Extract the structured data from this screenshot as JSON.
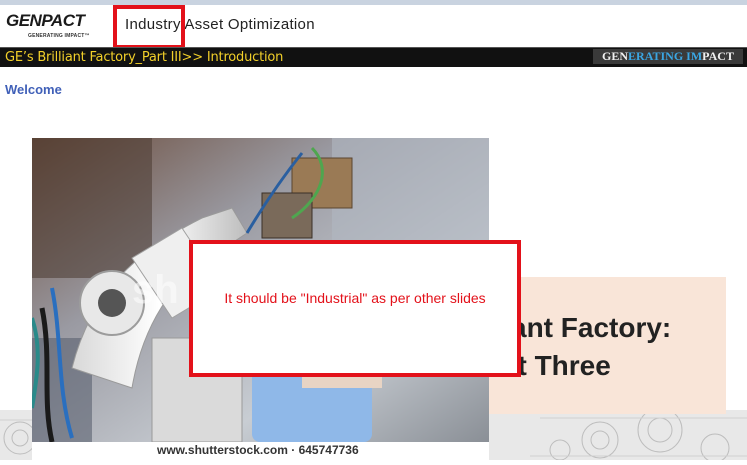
{
  "header": {
    "logo_text": "GENPACT",
    "logo_tagline": "GENERATING IMPACT™",
    "title": "Industry Asset Optimization"
  },
  "breadcrumb_bar": {
    "breadcrumb": "GE’s Brilliant Factory_Part III>> Introduction",
    "brand_gen": "GEN",
    "brand_erating": "ERATING",
    "brand_im": " IM",
    "brand_pact": "PACT"
  },
  "content": {
    "welcome": "Welcome",
    "slide_title_line1": "ant Factory:",
    "slide_title_line2": "art Three",
    "photo_caption": "www.shutterstock.com · 645747736",
    "watermark": "sh"
  },
  "comment": {
    "text": "It should be \"Industrial\" as per other slides"
  },
  "colors": {
    "highlight": "#e3111a",
    "breadcrumb_text": "#f2d02a",
    "welcome": "#4060b8",
    "peach": "#f9e5d8"
  }
}
